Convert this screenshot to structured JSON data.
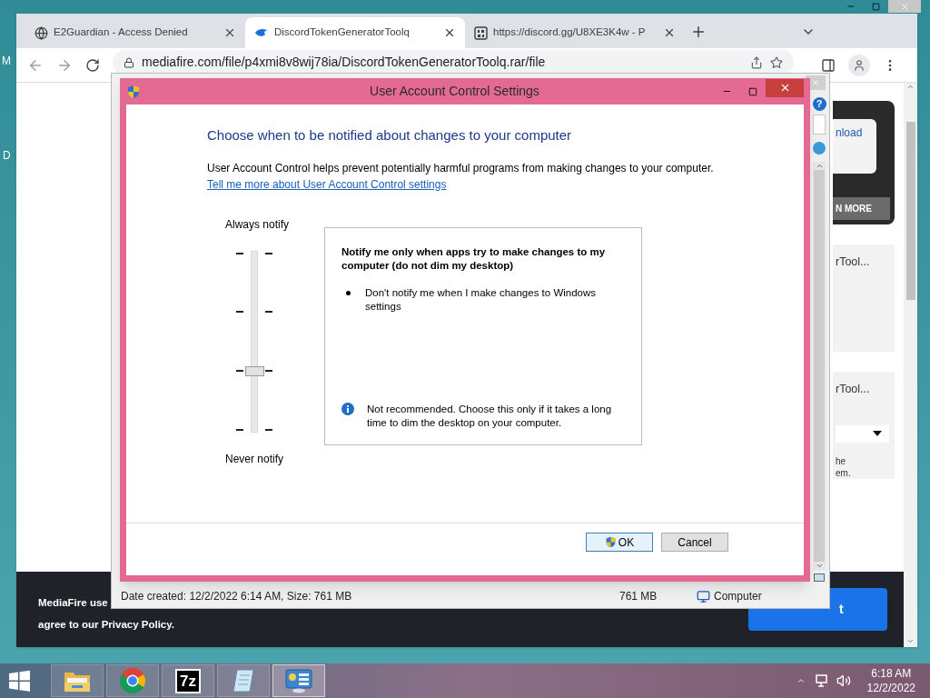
{
  "desktop_labels": [
    "M",
    "D"
  ],
  "browser": {
    "tabs": [
      {
        "title": "E2Guardian - Access Denied",
        "selected": false
      },
      {
        "title": "DiscordTokenGeneratorToolq",
        "selected": true
      },
      {
        "title": "https://discord.gg/U8XE3K4w - P",
        "selected": false
      }
    ],
    "address": "mediafire.com/file/p4xmi8v8wij78ia/DiscordTokenGeneratorToolq.rar/file"
  },
  "page": {
    "download_button": "nload",
    "learn_more_button": "N MORE",
    "cards": [
      {
        "title": "rTool..."
      },
      {
        "title": "rTool...",
        "lines": [
          "he",
          "em."
        ]
      }
    ],
    "cookie_banner": {
      "lines": [
        "MediaFire use",
        "agree to our Privacy Policy."
      ],
      "button": "t"
    }
  },
  "explorer": {
    "help": "?",
    "status": {
      "details": "Date created: 12/2/2022 6:14 AM, Size: 761 MB",
      "size": "761 MB",
      "location": "Computer"
    }
  },
  "dialog": {
    "title": "User Account Control Settings",
    "heading": "Choose when to be notified about changes to your computer",
    "description": "User Account Control helps prevent potentially harmful programs from making changes to your computer.",
    "link": "Tell me more about User Account Control settings",
    "slider": {
      "top_label": "Always notify",
      "bottom_label": "Never notify",
      "level": 0.33
    },
    "info": {
      "title": "Notify me only when apps try to make changes to my computer (do not dim my desktop)",
      "bullets": [
        "Don't notify me when I make changes to Windows settings"
      ],
      "note": "Not recommended. Choose this only if it takes a long time to dim the desktop on your computer."
    },
    "buttons": [
      {
        "label": "OK",
        "kind": "default"
      },
      {
        "label": "Cancel",
        "kind": "normal"
      }
    ]
  },
  "taskbar": {
    "apps": [
      {
        "kind": "explorer",
        "selected": false
      },
      {
        "kind": "chrome",
        "selected": false
      },
      {
        "kind": "archiver",
        "label": "7z",
        "selected": false
      },
      {
        "kind": "notepad",
        "selected": false
      },
      {
        "kind": "control-panel",
        "selected": true
      }
    ],
    "clock": {
      "time": "6:18 AM",
      "date": "12/2/2022"
    }
  }
}
